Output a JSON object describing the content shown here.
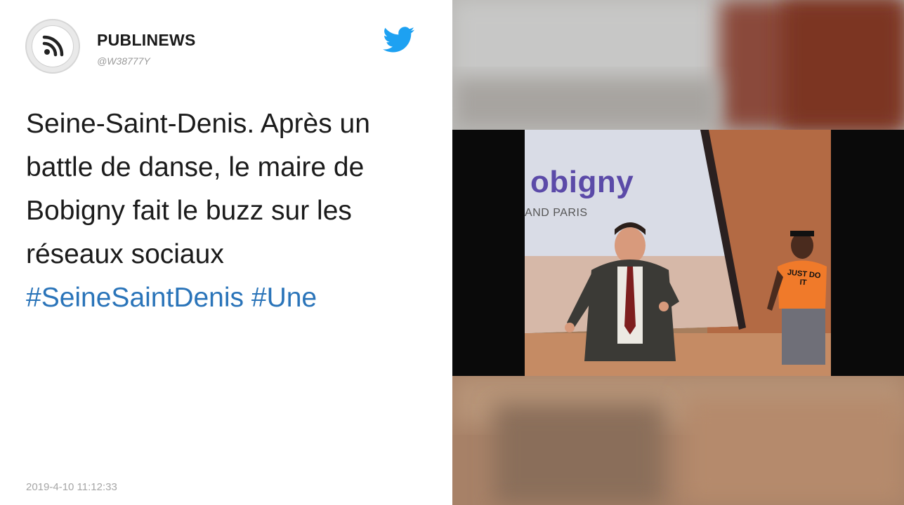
{
  "account": {
    "name": "PUBLINEWS",
    "handle": "@W38777Y",
    "avatar_icon": "rss-feed-icon"
  },
  "brand": {
    "icon": "twitter-bird-icon",
    "color": "#1da1f2"
  },
  "tweet": {
    "text": "Seine-Saint-Denis. Après un battle de danse, le maire de Bobigny fait le buzz sur les réseaux sociaux",
    "hashtags": [
      "#SeineSaintDenis",
      "#Une"
    ],
    "hashtag_color": "#2a74b9",
    "timestamp": "2019-4-10 11:12:33"
  },
  "video": {
    "slide_title": "obigny",
    "slide_subtitle": "AND PARIS",
    "shirt_text": "JUST DO IT"
  }
}
